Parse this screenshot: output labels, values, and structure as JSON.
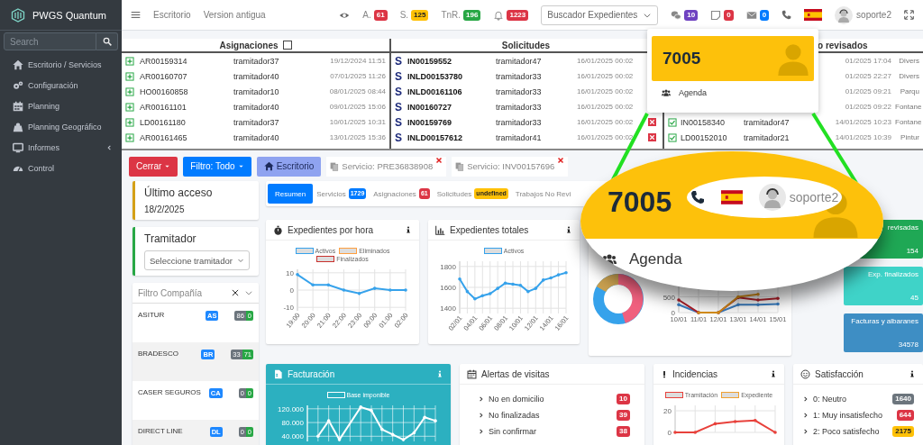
{
  "sidebar": {
    "brand": "PWGS Quantum",
    "search": {
      "placeholder": "Search"
    },
    "items": [
      {
        "label": "Escritorio / Servicios",
        "expandable": false
      },
      {
        "label": "Configuración",
        "expandable": false
      },
      {
        "label": "Planning",
        "expandable": false
      },
      {
        "label": "Planning Geográfico",
        "expandable": false
      },
      {
        "label": "Informes",
        "expandable": true
      },
      {
        "label": "Control",
        "expandable": false
      }
    ]
  },
  "topbar": {
    "links": [
      "Escritorio",
      "Version antigua"
    ],
    "counters": [
      {
        "label": "A.",
        "count": "61",
        "color": "#dc3545"
      },
      {
        "label": "S.",
        "count": "125",
        "color": "#ffc107"
      },
      {
        "label": "TnR.",
        "count": "196",
        "color": "#28a745"
      }
    ],
    "notifications": {
      "count": "1223"
    },
    "search": {
      "placeholder": "Buscador Expedientes"
    },
    "badges": [
      {
        "count": "10",
        "color": "#6f42c1"
      },
      {
        "count": "0",
        "color": "#dc3545"
      },
      {
        "count": "0",
        "color": "#007bff"
      }
    ],
    "user": "soporte2"
  },
  "tables": {
    "assignments": {
      "title": "Asignaciones",
      "checked": false,
      "rows": [
        {
          "id": "AR00159314",
          "user": "tramitador37",
          "date": "19/12/2024 11:51"
        },
        {
          "id": "AR00160707",
          "user": "tramitador40",
          "date": "07/01/2025 11:26"
        },
        {
          "id": "HO00160858",
          "user": "tramitador10",
          "date": "08/01/2025 08:44"
        },
        {
          "id": "AR00161101",
          "user": "tramitador40",
          "date": "09/01/2025 15:06"
        },
        {
          "id": "LD00161180",
          "user": "tramitador37",
          "date": "10/01/2025 10:31"
        },
        {
          "id": "AR00161465",
          "user": "tramitador40",
          "date": "13/01/2025 15:36"
        }
      ]
    },
    "requests": {
      "title": "Solicitudes",
      "rows": [
        {
          "marker": "S",
          "id": "IN00159552",
          "user": "tramitador47",
          "date": "16/01/2025 00:02"
        },
        {
          "marker": "S",
          "id": "INLD00153780",
          "user": "tramitador33",
          "date": "16/01/2025 00:02"
        },
        {
          "marker": "S",
          "id": "INLD00161106",
          "user": "tramitador33",
          "date": "16/01/2025 00:02"
        },
        {
          "marker": "S",
          "id": "IN00160727",
          "user": "tramitador33",
          "date": "16/01/2025 00:02"
        },
        {
          "marker": "S",
          "id": "IN00159769",
          "user": "tramitador33",
          "date": "16/01/2025 00:02"
        },
        {
          "marker": "S",
          "id": "INLD00157612",
          "user": "tramitador41",
          "date": "16/01/2025 00:02"
        }
      ]
    },
    "reviewed": {
      "title": "o revisados",
      "rows": [
        {
          "date": "01/2025 17:04",
          "type": "Divers"
        },
        {
          "date": "01/2025 22:27",
          "type": "Divers"
        },
        {
          "date": "01/2025 09:21",
          "type": "Parqu"
        },
        {
          "date": "01/2025 09:22",
          "type": "Fontane"
        },
        {
          "id": "IN00158340",
          "user": "tramitador47",
          "date": "14/01/2025 10:23",
          "type": "Fontane"
        },
        {
          "id": "LD00152010",
          "user": "tramitador21",
          "date": "14/01/2025 10:39",
          "type": "Pintur"
        }
      ]
    }
  },
  "dropdown": {
    "extension": "7005",
    "items": [
      "Agenda"
    ]
  },
  "actions": {
    "buttons": [
      {
        "label": "Cerrar",
        "kind": "danger"
      },
      {
        "label": "Filtro: Todo",
        "kind": "primary"
      },
      {
        "label": "Escritorio",
        "kind": "home"
      }
    ],
    "services": [
      "Servicio: PRE36838908",
      "Servicio: INV00157696"
    ]
  },
  "last_access": {
    "title": "Último acceso",
    "date": "18/2/2025"
  },
  "handler": {
    "title": "Tramitador",
    "placeholder": "Seleccione tramitador"
  },
  "company_filter": {
    "placeholder": "Filtro Compañía",
    "companies": [
      {
        "name": "ASITUR",
        "code": "AS",
        "count_a": "86",
        "count_b": "0"
      },
      {
        "name": "BRADESCO",
        "code": "BR",
        "count_a": "33",
        "count_b": "71"
      },
      {
        "name": "CASER SEGUROS",
        "code": "CA",
        "count_a": "0",
        "count_b": "0"
      },
      {
        "name": "DIRECT LINE",
        "code": "DL",
        "count_a": "0",
        "count_b": "0"
      }
    ]
  },
  "tabs": [
    {
      "label": "Resumen",
      "selected": true
    },
    {
      "label": "Servicios",
      "badge": "1729",
      "color": "#007bff",
      "selected": false
    },
    {
      "label": "Asignaciones",
      "badge": "61",
      "color": "#dc3545",
      "selected": false
    },
    {
      "label": "Solicitudes",
      "badge": "undefined",
      "color": "#ffc107",
      "selected": false
    },
    {
      "label": "Trabajos No Revi",
      "selected": false
    }
  ],
  "hourly": {
    "title": "Expedientes por hora",
    "chart_data": {
      "type": "line",
      "grid": true,
      "categories": [
        "19:00",
        "20:00",
        "21:00",
        "22:00",
        "23:00",
        "00:00",
        "01:00",
        "02:00"
      ],
      "ylim": [
        -12,
        12
      ],
      "yticks": [
        10,
        0,
        -10
      ],
      "series": [
        {
          "name": "Activos",
          "color": "#36a2eb",
          "values": [
            9,
            3,
            3,
            0,
            -2,
            1,
            0,
            0
          ]
        },
        {
          "name": "Eliminados",
          "color": "#ff9f40",
          "values": [
            null,
            null,
            null,
            null,
            null,
            null,
            null,
            null
          ]
        },
        {
          "name": "Finalizados",
          "color": "#c9302c",
          "values": [
            null,
            null,
            null,
            null,
            null,
            null,
            null,
            null
          ]
        }
      ]
    }
  },
  "totals": {
    "title": "Expedientes totales",
    "chart_data": {
      "type": "line",
      "grid": true,
      "categories": [
        "02/01",
        null,
        "04/01",
        null,
        "06/01",
        null,
        "08/01",
        null,
        "10/01",
        null,
        "12/01",
        null,
        "14/01",
        null,
        "16/01"
      ],
      "ylim": [
        1350,
        1850
      ],
      "yticks": [
        1800,
        1600,
        1400
      ],
      "series": [
        {
          "name": "Activos",
          "color": "#36a2eb",
          "values": [
            1680,
            1560,
            1490,
            1520,
            1540,
            1590,
            1640,
            1630,
            1620,
            1560,
            1590,
            1670,
            1690,
            1720,
            1740
          ]
        }
      ]
    }
  },
  "mixed": {
    "chart_data": {
      "type": "line",
      "grid": true,
      "categories": [
        "10/01",
        "11/01",
        "12/01",
        "13/01",
        "14/01",
        "15/01"
      ],
      "ylim": [
        0,
        1200
      ],
      "yticks": [
        500,
        0
      ],
      "series": [
        {
          "color": "#3a7fc4",
          "values": [
            250,
            0,
            0,
            250,
            250,
            270
          ]
        },
        {
          "color": "#b0202a",
          "values": [
            400,
            0,
            0,
            480,
            400,
            450
          ]
        },
        {
          "color": "#d9901a",
          "values": [
            null,
            0,
            0,
            500,
            580,
            null
          ]
        }
      ]
    }
  },
  "tiles": [
    {
      "title": "revisadas",
      "value": "154",
      "color": "#1fa855"
    },
    {
      "title": "Exp. finalizados",
      "value": "45",
      "color": "#3fd3c8"
    },
    {
      "title": "Facturas y albaranes",
      "value": "34578",
      "color": "#3e8ec4"
    }
  ],
  "billing": {
    "title": "Facturación",
    "chart_data": {
      "type": "line",
      "grid": true,
      "categories": [
        null,
        null,
        null,
        null,
        null,
        null,
        null,
        null,
        null,
        null,
        null,
        null,
        null
      ],
      "ylim": [
        25000,
        130000
      ],
      "yticks": [
        {
          "value": 120000,
          "label": "120.000"
        },
        {
          "value": 80000,
          "label": "80.000"
        },
        {
          "value": 40000,
          "label": "40.000"
        }
      ],
      "series": [
        {
          "name": "Base imponible",
          "color": "#ffffff",
          "values": [
            null,
            40000,
            85000,
            30000,
            null,
            125000,
            115000,
            60000,
            45000,
            30000,
            50000,
            95000,
            85000
          ]
        }
      ]
    }
  },
  "visit_alerts": {
    "title": "Alertas de visitas",
    "items": [
      {
        "label": "No en domicilio",
        "count": "10"
      },
      {
        "label": "No finalizadas",
        "count": "39"
      },
      {
        "label": "Sin confirmar",
        "count": "38"
      }
    ]
  },
  "incidents": {
    "title": "Incidencias",
    "chart_data": {
      "type": "line",
      "grid": true,
      "categories": [
        null,
        null,
        null,
        null,
        null,
        null
      ],
      "ylim": [
        0,
        25
      ],
      "yticks": [
        20,
        0
      ],
      "series": [
        {
          "name": "Tramitación",
          "color": "#e8413b",
          "values": [
            0,
            0,
            8,
            10,
            11,
            0
          ]
        },
        {
          "name": "Expediente",
          "color": "#f0a030",
          "values": [
            null,
            null,
            null,
            null,
            null,
            null
          ]
        }
      ]
    }
  },
  "satisfaction": {
    "title": "Satisfacción",
    "items": [
      {
        "label": "0: Neutro",
        "count": "1640",
        "color": "#6c757d"
      },
      {
        "label": "1: Muy insatisfecho",
        "count": "644",
        "color": "#dc3545"
      },
      {
        "label": "2: Poco satisfecho",
        "count": "2175",
        "color": "#ffc107"
      }
    ]
  },
  "magnifier": {
    "extension": "7005",
    "user": "soporte2",
    "items": [
      "Agenda"
    ]
  }
}
